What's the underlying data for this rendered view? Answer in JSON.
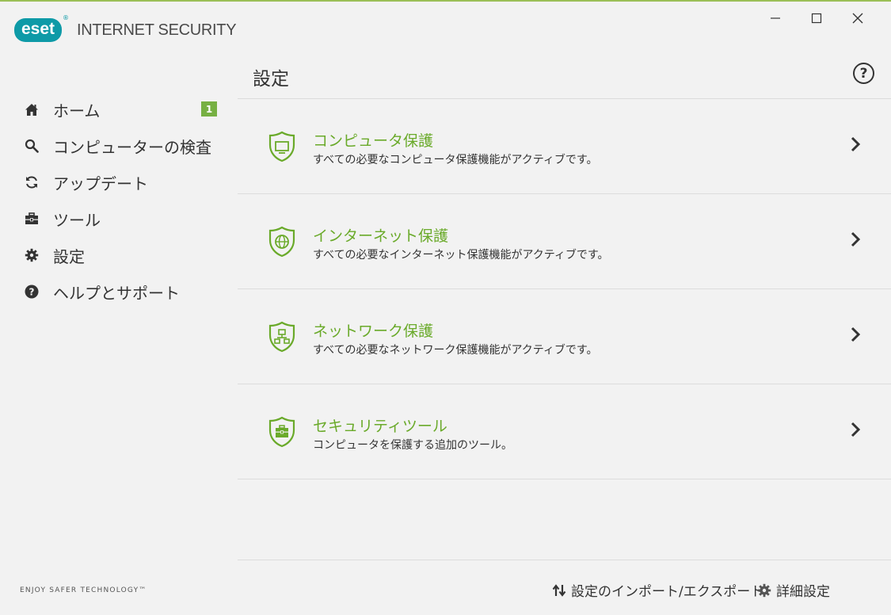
{
  "app": {
    "logo_text": "eset",
    "logo_reg": "®",
    "product_name": "INTERNET SECURITY",
    "tagline": "ENJOY SAFER TECHNOLOGY™"
  },
  "window": {
    "minimize": "—",
    "maximize": "☐",
    "close": "✕"
  },
  "sidebar": {
    "items": [
      {
        "label": "ホーム",
        "icon": "home-icon",
        "badge": "1"
      },
      {
        "label": "コンピューターの検査",
        "icon": "search-icon"
      },
      {
        "label": "アップデート",
        "icon": "refresh-icon"
      },
      {
        "label": "ツール",
        "icon": "toolbox-icon"
      },
      {
        "label": "設定",
        "icon": "gear-icon"
      },
      {
        "label": "ヘルプとサポート",
        "icon": "help-icon"
      }
    ]
  },
  "main": {
    "title": "設定",
    "help": "?",
    "rows": [
      {
        "title": "コンピュータ保護",
        "desc": "すべての必要なコンピュータ保護機能がアクティブです。",
        "icon": "shield-monitor-icon"
      },
      {
        "title": "インターネット保護",
        "desc": "すべての必要なインターネット保護機能がアクティブです。",
        "icon": "shield-globe-icon"
      },
      {
        "title": "ネットワーク保護",
        "desc": "すべての必要なネットワーク保護機能がアクティブです。",
        "icon": "shield-network-icon"
      },
      {
        "title": "セキュリティツール",
        "desc": "コンピュータを保護する追加のツール。",
        "icon": "shield-toolbox-icon"
      }
    ],
    "footer": {
      "import_export": "設定のインポート/エクスポート",
      "advanced": "詳細設定"
    }
  },
  "colors": {
    "accent_green": "#6aaa2a",
    "badge_green": "#77b043",
    "logo_teal": "#0e9aa7"
  }
}
